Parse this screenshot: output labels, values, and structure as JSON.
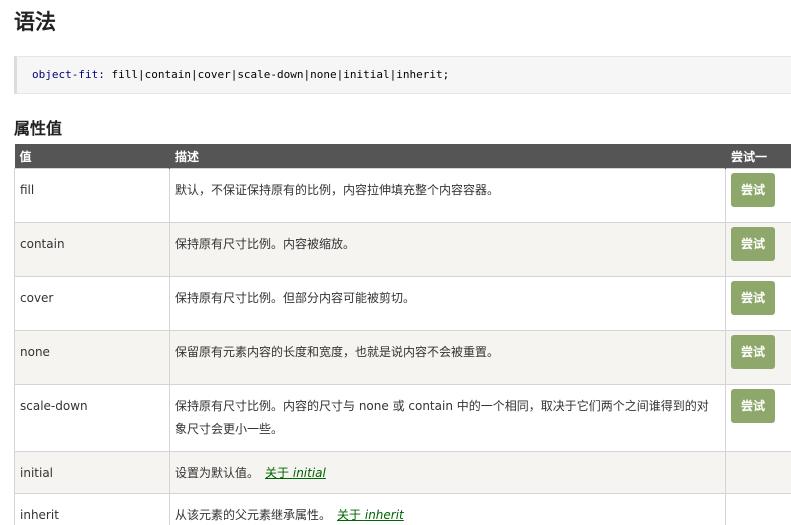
{
  "heading_syntax": "语法",
  "syntax_code": {
    "property": "object-fit:",
    "values": "fill|contain|cover|scale-down|none|initial|inherit;"
  },
  "heading_values": "属性值",
  "table": {
    "headers": [
      "值",
      "描述",
      "尝试一"
    ],
    "try_label": "尝试",
    "rows": [
      {
        "value": "fill",
        "desc": "默认，不保证保持原有的比例，内容拉伸填充整个内容容器。",
        "has_try": true
      },
      {
        "value": "contain",
        "desc": "保持原有尺寸比例。内容被缩放。",
        "has_try": true
      },
      {
        "value": "cover",
        "desc": "保持原有尺寸比例。但部分内容可能被剪切。",
        "has_try": true
      },
      {
        "value": "none",
        "desc": "保留原有元素内容的长度和宽度，也就是说内容不会被重置。",
        "has_try": true
      },
      {
        "value": "scale-down",
        "desc": "保持原有尺寸比例。内容的尺寸与 none 或 contain 中的一个相同，取决于它们两个之间谁得到的对象尺寸会更小一些。",
        "has_try": true
      },
      {
        "value": "initial",
        "desc": "设置为默认值。",
        "link_prefix": "关于",
        "link_value": "initial",
        "has_try": false
      },
      {
        "value": "inherit",
        "desc": "从该元素的父元素继承属性。",
        "link_prefix": "关于",
        "link_value": "inherit",
        "has_try": false
      }
    ]
  }
}
